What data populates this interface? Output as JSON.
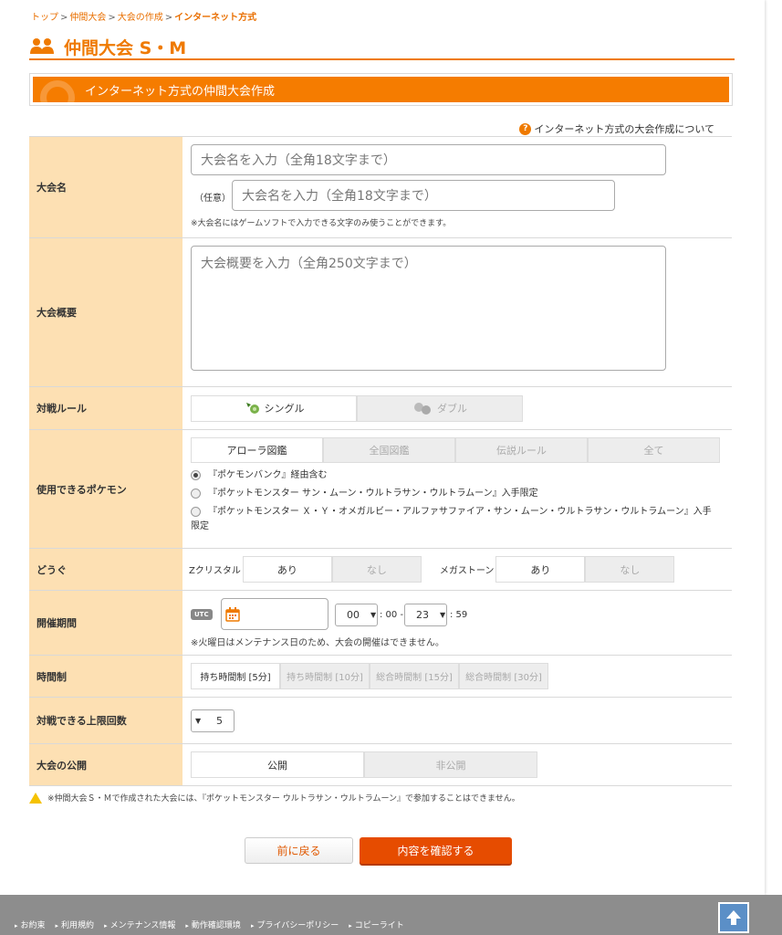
{
  "breadcrumb": [
    "トップ",
    "仲間大会",
    "大会の作成",
    "インターネット方式"
  ],
  "breadcrumb_sep": ">",
  "page_title": "仲間大会 S・M",
  "section_bar": "インターネット方式の仲間大会作成",
  "help_link": "インターネット方式の大会作成について",
  "help_icon": "?",
  "form": {
    "name": {
      "label": "大会名",
      "placeholder1": "大会名を入力（全角18文字まで）",
      "optional_label": "（任意）",
      "placeholder2": "大会名を入力（全角18文字まで）",
      "note": "※大会名にはゲームソフトで入力できる文字のみ使うことができます。"
    },
    "summary": {
      "label": "大会概要",
      "placeholder": "大会概要を入力（全角250文字まで）"
    },
    "rule": {
      "label": "対戦ルール",
      "options": [
        "シングル",
        "ダブル"
      ]
    },
    "pokemon": {
      "label": "使用できるポケモン",
      "tabs": [
        "アローラ図鑑",
        "全国図鑑",
        "伝説ルール",
        "全て"
      ],
      "radios": [
        "『ポケモンバンク』経由含む",
        "『ポケットモンスター サン・ムーン・ウルトラサン・ウルトラムーン』入手限定",
        "『ポケットモンスター Ｘ・Ｙ・オメガルビー・アルファサファイア・サン・ムーン・ウルトラサン・ウルトラムーン』入手限定"
      ]
    },
    "items": {
      "label": "どうぐ",
      "z_label": "Zクリスタル",
      "z_options": [
        "あり",
        "なし"
      ],
      "mega_label": "メガストーン",
      "mega_options": [
        "あり",
        "なし"
      ]
    },
    "period": {
      "label": "開催期間",
      "utc": "UTC",
      "start_hour": "00",
      "sep1": ": 00 -",
      "end_hour": "23",
      "sep2": ": 59",
      "note": "※火曜日はメンテナンス日のため、大会の開催はできません。"
    },
    "time": {
      "label": "時間制",
      "options": [
        "持ち時間制 [5分]",
        "持ち時間制 [10分]",
        "総合時間制 [15分]",
        "総合時間制 [30分]"
      ]
    },
    "limit": {
      "label": "対戦できる上限回数",
      "value": "5"
    },
    "publish": {
      "label": "大会の公開",
      "options": [
        "公開",
        "非公開"
      ]
    }
  },
  "warning": "※仲間大会Ｓ・Ｍで作成された大会には、『ポケットモンスター ウルトラサン・ウルトラムーン』で参加することはできません。",
  "buttons": {
    "back": "前に戻る",
    "confirm": "内容を確認する"
  },
  "footer_links": [
    "お約束",
    "利用規約",
    "メンテナンス情報",
    "動作確認環境",
    "プライバシーポリシー",
    "コピーライト"
  ],
  "icons": [
    "people-icon",
    "help-icon",
    "single-battle-icon",
    "double-battle-icon",
    "calendar-icon",
    "warning-icon",
    "arrow-up-icon"
  ],
  "colors": {
    "accent": "#ef7a00",
    "label_bg": "#fde0b3",
    "confirm": "#e64c00",
    "footer": "#8d8d8d"
  }
}
